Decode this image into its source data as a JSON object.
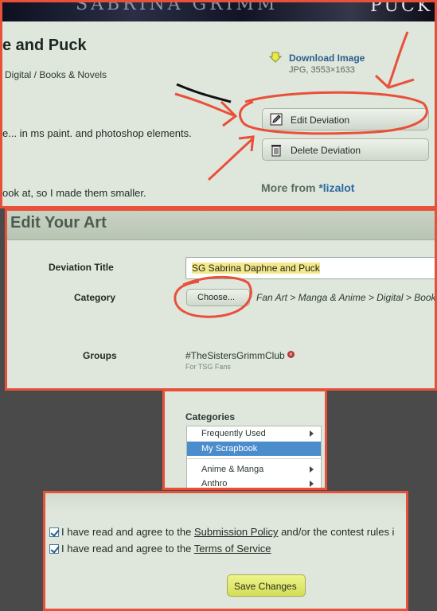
{
  "top": {
    "banner_text": "SABRINA GRIMM",
    "banner_right": "PUCK",
    "title": "e and Puck",
    "category": "Digital / Books & Novels",
    "download_label": "Download Image",
    "file_info": "JPG, 3553×1633",
    "edit_label": "Edit Deviation",
    "delete_label": "Delete Deviation",
    "description_1": "e... in ms paint. and photoshop elements.",
    "description_2": "ook at, so I made them smaller.",
    "more_from_prefix": "More from ",
    "more_from_user": "*lizalot"
  },
  "edit_form": {
    "heading": "Edit Your Art",
    "title_label": "Deviation Title",
    "title_value": "SG Sabrina Daphne and Puck",
    "category_label": "Category",
    "choose_label": "Choose...",
    "category_path": "Fan Art > Manga & Anime > Digital > Book",
    "groups_label": "Groups",
    "group_name": "#TheSistersGrimmClub",
    "group_desc": "For TSG Fans"
  },
  "categories": {
    "heading": "Categories",
    "items": [
      {
        "label": "Frequently Used",
        "has_arrow": true
      },
      {
        "label": "My Scrapbook",
        "has_arrow": false,
        "selected": true
      },
      {
        "label": "Anime & Manga",
        "has_arrow": true
      },
      {
        "label": "Anthro",
        "has_arrow": true
      }
    ]
  },
  "agreement": {
    "line1_prefix": "I have read and agree to the ",
    "line1_link": "Submission Policy",
    "line1_suffix": " and/or the contest rules i",
    "line2_prefix": "I have read and agree to the ",
    "line2_link": "Terms of Service",
    "save_label": "Save Changes"
  },
  "colors": {
    "annotation": "#e8503a",
    "link": "#2b5f8c",
    "panel": "#dfe6dc",
    "save_button": "#dfe96a",
    "selected": "#4b8ccc"
  },
  "icons": [
    "download-arrow-icon",
    "edit-icon",
    "trash-icon",
    "remove-group-icon",
    "chevron-right-icon",
    "checkbox-checked-icon"
  ]
}
